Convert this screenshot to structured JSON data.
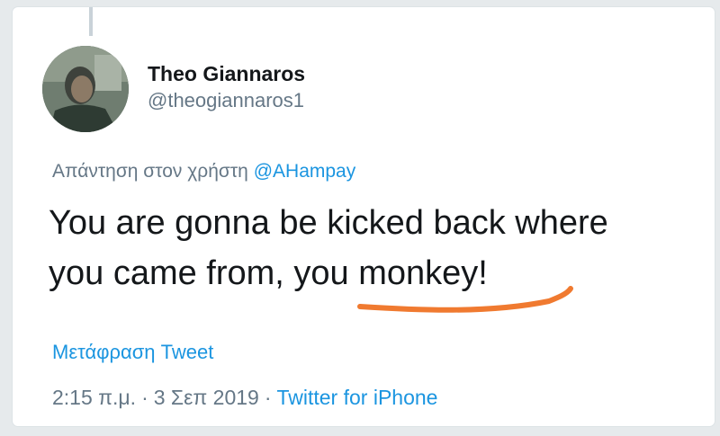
{
  "tweet": {
    "author": {
      "display_name": "Theo Giannaros",
      "handle": "@theogiannaros1",
      "avatar_icon": "profile-photo"
    },
    "reply_prefix": "Απάντηση στον χρήστη",
    "reply_mention": "@AHampay",
    "text_line1": "You are gonna be kicked back where",
    "text_line2": "you came from, you monkey!",
    "translate_link": "Μετάφραση Tweet",
    "time": "2:15 π.μ.",
    "separator": "·",
    "date": "3 Σεπ 2019",
    "source": "Twitter for iPhone"
  },
  "colors": {
    "text": "#14171a",
    "secondary": "#657786",
    "link": "#1b95e0",
    "highlight_underline": "#f07a30"
  }
}
